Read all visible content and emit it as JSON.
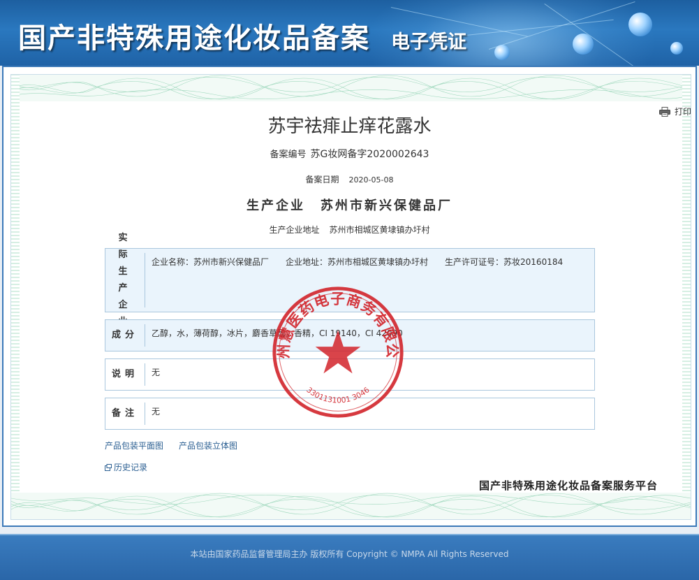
{
  "banner": {
    "title": "国产非特殊用途化妆品备案",
    "subtitle": "电子凭证"
  },
  "toolbar": {
    "print_label": "打印",
    "print_icon": "printer-icon"
  },
  "product": {
    "name": "苏宇祛痱止痒花露水",
    "record_no_label": "备案编号",
    "record_no": "苏G妆网备字2020002643",
    "record_date_label": "备案日期",
    "record_date": "2020-05-08",
    "producer_label": "生产企业",
    "producer": "苏州市新兴保健品厂",
    "producer_addr_label": "生产企业地址",
    "producer_addr": "苏州市相城区黄埭镇办圩村"
  },
  "sections": {
    "actual_producer": {
      "label": "实际生产企业",
      "company_name": "企业名称：苏州市新兴保健品厂",
      "company_addr": "企业地址：苏州市相城区黄埭镇办圩村",
      "license": "生产许可证号：苏妆20160184"
    },
    "ingredients": {
      "label": "成分",
      "value": "乙醇，水，薄荷醇，冰片，麝香草酚，香精，CI 19140，CI 42090"
    },
    "description": {
      "label": "说明",
      "value": "无"
    },
    "remarks": {
      "label": "备注",
      "value": "无"
    }
  },
  "links": {
    "flat_image": "产品包装平面图",
    "stereo_image": "产品包装立体图",
    "history": "历史记录",
    "history_icon": "external-link-icon"
  },
  "seal": {
    "org": "杭州慧医药电子商务有限公司",
    "code": "3301131001 3046",
    "color": "#d2232a"
  },
  "platform": "国产非特殊用途化妆品备案服务平台",
  "footer": {
    "text": "本站由国家药品监督管理局主办 版权所有 Copyright © NMPA All Rights Reserved"
  },
  "colors": {
    "banner": "#2a78bf",
    "frame_border": "#3b78b8",
    "info_box_bg": "#eaf4fc",
    "link": "#2b5f92",
    "footer": "#2a66a8"
  }
}
